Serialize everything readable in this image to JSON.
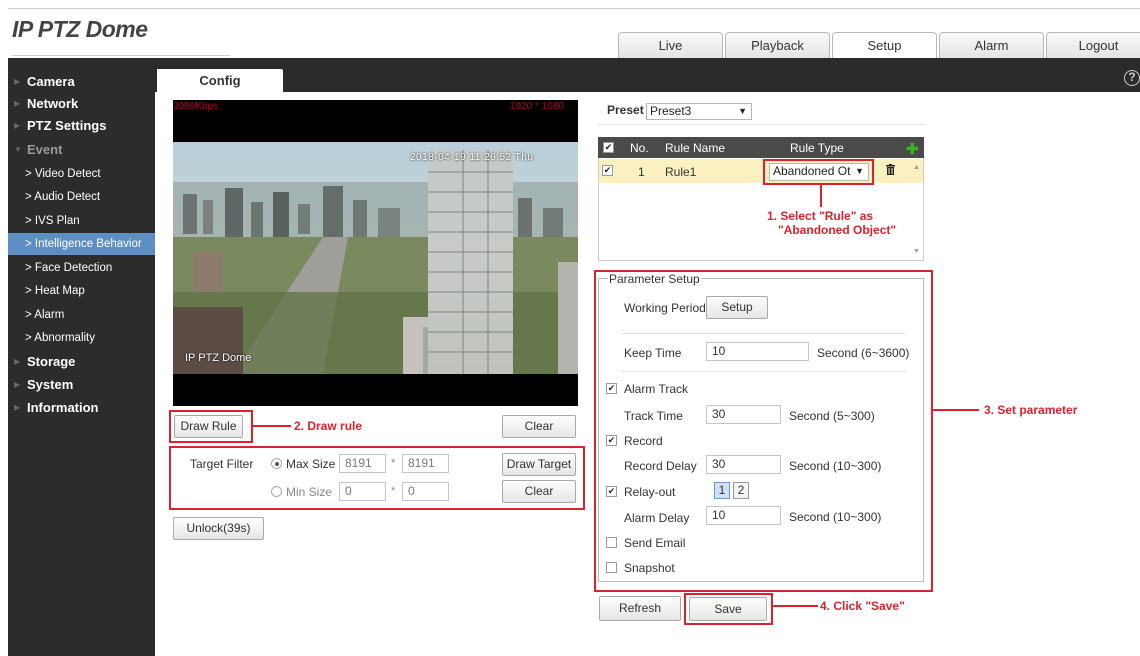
{
  "app": {
    "title": "IP PTZ Dome"
  },
  "tabs": [
    {
      "label": "Live",
      "active": false
    },
    {
      "label": "Playback",
      "active": false
    },
    {
      "label": "Setup",
      "active": true
    },
    {
      "label": "Alarm",
      "active": false
    },
    {
      "label": "Logout",
      "active": false
    }
  ],
  "sidebar": {
    "items": [
      {
        "label": "Camera"
      },
      {
        "label": "Network"
      },
      {
        "label": "PTZ Settings"
      },
      {
        "label": "Event"
      },
      {
        "label": "> Video Detect"
      },
      {
        "label": "> Audio Detect"
      },
      {
        "label": "> IVS Plan"
      },
      {
        "label": "> Intelligence Behavior"
      },
      {
        "label": "> Face Detection"
      },
      {
        "label": "> Heat Map"
      },
      {
        "label": "> Alarm"
      },
      {
        "label": "> Abnormality"
      },
      {
        "label": "Storage"
      },
      {
        "label": "System"
      },
      {
        "label": "Information"
      }
    ]
  },
  "config_tab": {
    "label": "Config"
  },
  "help": {
    "label": "?"
  },
  "video": {
    "bitrate": "3989Kbps",
    "resolution": "1920 * 1080",
    "timestamp": "2018-04-19 11:26:52 Thu",
    "camera_name": "IP PTZ Dome"
  },
  "draw": {
    "draw_rule": "Draw Rule",
    "clear": "Clear"
  },
  "target_filter": {
    "label": "Target Filter",
    "max_label": "Max Size",
    "max_w": "8191",
    "max_h": "8191",
    "min_label": "Min Size",
    "min_w": "0",
    "min_h": "0",
    "star": "*",
    "draw_target": "Draw Target",
    "clear": "Clear"
  },
  "unlock": {
    "label": "Unlock(39s)"
  },
  "preset": {
    "label": "Preset",
    "value": "Preset3"
  },
  "rules": {
    "headers": {
      "no": "No.",
      "name": "Rule Name",
      "type": "Rule Type"
    },
    "rows": [
      {
        "no": "1",
        "name": "Rule1",
        "type": "Abandoned Ot"
      }
    ]
  },
  "params": {
    "title": "Parameter Setup",
    "working_period": "Working Period",
    "setup": "Setup",
    "keep_time": "Keep Time",
    "keep_time_value": "10",
    "keep_time_unit": "Second (6~3600)",
    "alarm_track": "Alarm Track",
    "track_time": "Track Time",
    "track_time_value": "30",
    "track_time_unit": "Second (5~300)",
    "record": "Record",
    "record_delay": "Record Delay",
    "record_delay_value": "30",
    "record_delay_unit": "Second (10~300)",
    "relay_out": "Relay-out",
    "relay_1": "1",
    "relay_2": "2",
    "alarm_delay": "Alarm Delay",
    "alarm_delay_value": "10",
    "alarm_delay_unit": "Second (10~300)",
    "send_email": "Send Email",
    "snapshot": "Snapshot"
  },
  "actions": {
    "refresh": "Refresh",
    "save": "Save"
  },
  "annotations": {
    "select_rule_1": "1. Select \"Rule\" as",
    "select_rule_2": "\"Abandoned Object\"",
    "draw_rule": "2. Draw rule",
    "set_param": "3. Set parameter",
    "click_save": "4. Click \"Save\""
  },
  "colors": {
    "annotation": "#d9232e",
    "sidebar_bg": "#2c2c2c",
    "sidebar_active": "#5e8fc4",
    "rule_row": "#fbf0c0"
  }
}
